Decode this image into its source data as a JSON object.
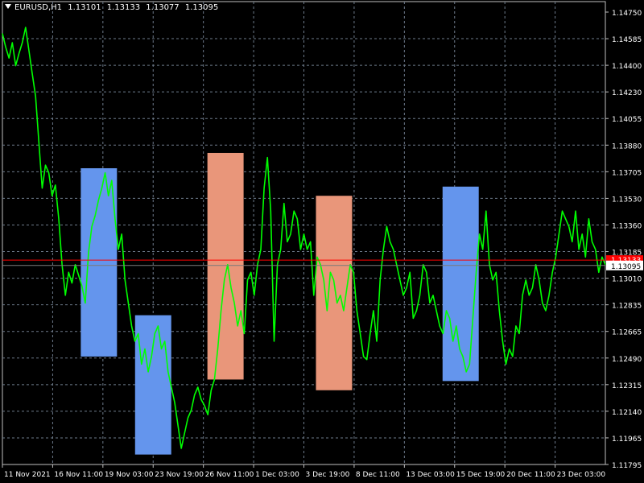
{
  "header": {
    "symbol": "EURUSD,H1",
    "open": "1.13101",
    "high": "1.13133",
    "low": "1.13077",
    "close": "1.13095"
  },
  "chart_data": {
    "type": "line",
    "grid": true,
    "ylim": [
      1.11795,
      1.1475
    ],
    "y_ticks": [
      "1.14750",
      "1.14585",
      "1.14400",
      "1.14230",
      "1.14055",
      "1.13880",
      "1.13705",
      "1.13530",
      "1.13360",
      "1.13185",
      "1.13010",
      "1.12835",
      "1.12665",
      "1.12490",
      "1.12315",
      "1.12140",
      "1.11965",
      "1.11795"
    ],
    "x_ticks": [
      "11 Nov 2021",
      "16 Nov 11:00",
      "19 Nov 03:00",
      "23 Nov 19:00",
      "26 Nov 11:00",
      "1 Dec 03:00",
      "3 Dec 19:00",
      "8 Dec 11:00",
      "13 Dec 03:00",
      "15 Dec 19:00",
      "20 Dec 11:00",
      "23 Dec 03:00"
    ],
    "current_price_label": "1.13095",
    "current_price": 1.13095,
    "red_level": 1.1313,
    "red_level_label": "1.13133",
    "colors": {
      "background": "#000000",
      "price_line": "#00ff00",
      "grid": "#6e7b8b",
      "blue_box": "#6495ed",
      "salmon_box": "#e9967a",
      "red_line": "#ff0000",
      "axis_text": "#ffffff"
    },
    "series": [
      {
        "values": [
          1.1461,
          1.1452,
          1.1445,
          1.1455,
          1.144,
          1.1448,
          1.1455,
          1.1465,
          1.145,
          1.1435,
          1.142,
          1.139,
          1.136,
          1.1375,
          1.137,
          1.1355,
          1.1362,
          1.134,
          1.131,
          1.129,
          1.1305,
          1.1298,
          1.131,
          1.1303,
          1.1296,
          1.1285,
          1.1318,
          1.1335,
          1.1342,
          1.1352,
          1.136,
          1.137,
          1.1355,
          1.1365,
          1.134,
          1.132,
          1.133,
          1.13,
          1.1285,
          1.127,
          1.126,
          1.1265,
          1.1245,
          1.1255,
          1.124,
          1.125,
          1.1265,
          1.127,
          1.1255,
          1.126,
          1.124,
          1.123,
          1.122,
          1.1205,
          1.119,
          1.12,
          1.121,
          1.1215,
          1.1225,
          1.123,
          1.1222,
          1.1218,
          1.1212,
          1.1228,
          1.1235,
          1.1255,
          1.128,
          1.13,
          1.131,
          1.1295,
          1.1285,
          1.127,
          1.128,
          1.1265,
          1.13,
          1.1305,
          1.129,
          1.131,
          1.132,
          1.136,
          1.138,
          1.1345,
          1.126,
          1.131,
          1.132,
          1.135,
          1.1325,
          1.133,
          1.1345,
          1.134,
          1.132,
          1.133,
          1.132,
          1.1325,
          1.129,
          1.1315,
          1.131,
          1.13,
          1.128,
          1.1305,
          1.13,
          1.1285,
          1.129,
          1.128,
          1.1295,
          1.131,
          1.1305,
          1.128,
          1.1265,
          1.125,
          1.1248,
          1.1265,
          1.128,
          1.126,
          1.13,
          1.132,
          1.1335,
          1.1325,
          1.132,
          1.131,
          1.13,
          1.129,
          1.1295,
          1.1305,
          1.1275,
          1.128,
          1.129,
          1.131,
          1.1305,
          1.1285,
          1.129,
          1.128,
          1.127,
          1.1265,
          1.128,
          1.1275,
          1.126,
          1.127,
          1.1255,
          1.125,
          1.124,
          1.1245,
          1.1275,
          1.1305,
          1.133,
          1.132,
          1.1345,
          1.131,
          1.13,
          1.1305,
          1.128,
          1.126,
          1.1245,
          1.1255,
          1.125,
          1.127,
          1.1265,
          1.129,
          1.13,
          1.129,
          1.1295,
          1.131,
          1.13,
          1.1285,
          1.128,
          1.129,
          1.1305,
          1.1315,
          1.133,
          1.1345,
          1.134,
          1.1335,
          1.1325,
          1.1345,
          1.132,
          1.133,
          1.1315,
          1.134,
          1.1325,
          1.132,
          1.1305,
          1.1315,
          1.131
        ]
      }
    ],
    "boxes": [
      {
        "color": "blue",
        "x_start": 0.13,
        "x_end": 0.19,
        "y_top": 1.1373,
        "y_bottom": 1.125
      },
      {
        "color": "blue",
        "x_start": 0.22,
        "x_end": 0.28,
        "y_top": 1.1277,
        "y_bottom": 1.1186
      },
      {
        "color": "salmon",
        "x_start": 0.34,
        "x_end": 0.4,
        "y_top": 1.1383,
        "y_bottom": 1.1235
      },
      {
        "color": "salmon",
        "x_start": 0.52,
        "x_end": 0.58,
        "y_top": 1.1355,
        "y_bottom": 1.1228
      },
      {
        "color": "blue",
        "x_start": 0.73,
        "x_end": 0.79,
        "y_top": 1.1361,
        "y_bottom": 1.1234
      }
    ]
  }
}
